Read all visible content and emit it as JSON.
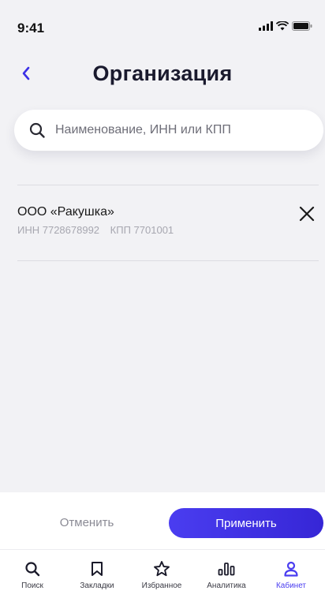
{
  "status_bar": {
    "time": "9:41"
  },
  "header": {
    "title": "Организация"
  },
  "search": {
    "placeholder": "Наименование, ИНН или КПП",
    "value": ""
  },
  "selected_orgs": [
    {
      "name": "ООО «Ракушка»",
      "inn": "ИНН 7728678992",
      "kpp": "КПП 7701001"
    }
  ],
  "actions": {
    "cancel_label": "Отменить",
    "apply_label": "Применить"
  },
  "bottom_nav": {
    "items": [
      {
        "label": "Поиск",
        "icon": "search-icon"
      },
      {
        "label": "Закладки",
        "icon": "bookmark-icon"
      },
      {
        "label": "Избранное",
        "icon": "star-icon"
      },
      {
        "label": "Аналитика",
        "icon": "bar-chart-icon"
      },
      {
        "label": "Кабинет",
        "icon": "user-icon",
        "active": true
      }
    ]
  },
  "colors": {
    "accent": "#4a3df0",
    "background": "#f2f2f5",
    "muted_text": "#a7a7b0"
  }
}
